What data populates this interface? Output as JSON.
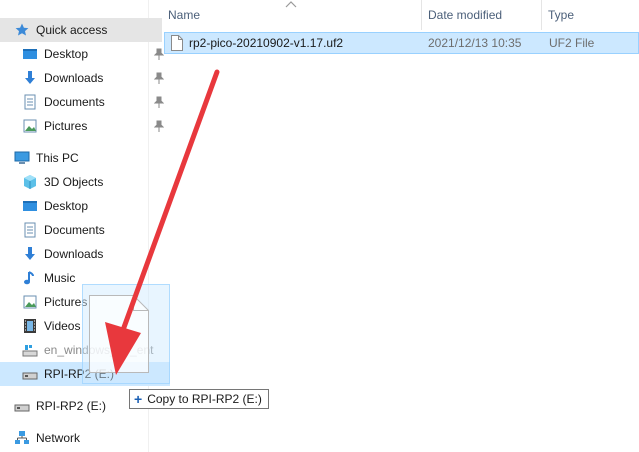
{
  "nav": {
    "quick_access": "Quick access",
    "qa_desktop": "Desktop",
    "qa_downloads": "Downloads",
    "qa_documents": "Documents",
    "qa_pictures": "Pictures",
    "this_pc": "This PC",
    "objects3d": "3D Objects",
    "desktop": "Desktop",
    "documents": "Documents",
    "downloads": "Downloads",
    "music": "Music",
    "pictures": "Pictures",
    "videos": "Videos",
    "en_windows": "en_windows_10_ent",
    "rpi_drive_pc": "RPI-RP2 (E:)",
    "rpi_drive": "RPI-RP2 (E:)",
    "network": "Network"
  },
  "columns": {
    "name": "Name",
    "date": "Date modified",
    "type": "Type"
  },
  "files": [
    {
      "name": "rp2-pico-20210902-v1.17.uf2",
      "date": "2021/12/13 10:35",
      "type": "UF2 File"
    }
  ],
  "drag": {
    "tooltip": "Copy to RPI-RP2 (E:)",
    "plus": "+"
  },
  "colors": {
    "selection": "#cce8ff",
    "arrow": "#e8383d",
    "accent": "#0078d7"
  }
}
